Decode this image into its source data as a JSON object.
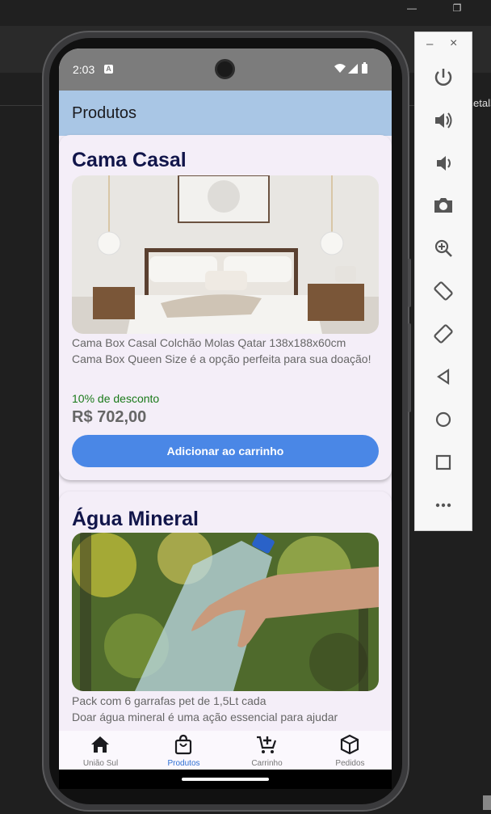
{
  "host": {
    "peek_text": "etalh"
  },
  "status_bar": {
    "time": "2:03",
    "notification_glyph": "A"
  },
  "app_bar": {
    "title": "Produtos"
  },
  "products": [
    {
      "title": "Cama Casal",
      "image": "bedroom-photo",
      "description": "Cama Box Casal Colchão Molas Qatar 138x188x60cm\nCama Box Queen Size é a opção perfeita para sua doação!",
      "discount": "10% de desconto",
      "price": "R$ 702,00",
      "button_label": "Adicionar ao carrinho"
    },
    {
      "title": "Água Mineral",
      "image": "water-bottle-photo",
      "description": "Pack com 6 garrafas pet de 1,5Lt cada\nDoar água mineral é uma ação essencial para ajudar comunidades em situações de emergência"
    }
  ],
  "bottom_nav": [
    {
      "label": "União Sul",
      "icon": "home-icon",
      "active": false
    },
    {
      "label": "Produtos",
      "icon": "shopping-bag-icon",
      "active": true
    },
    {
      "label": "Carrinho",
      "icon": "add-cart-icon",
      "active": false
    },
    {
      "label": "Pedidos",
      "icon": "package-icon",
      "active": false
    }
  ],
  "emulator_controls": {
    "minimize": "–",
    "close": "×",
    "buttons": [
      "power-icon",
      "volume-up-icon",
      "volume-down-icon",
      "camera-icon",
      "zoom-icon",
      "rotate-left-icon",
      "rotate-right-icon",
      "back-icon",
      "home-circle-icon",
      "overview-icon",
      "more-icon"
    ]
  },
  "colors": {
    "app_bar": "#a9c6e5",
    "title_text": "#11154a",
    "discount": "#1a7a1a",
    "button": "#4a87e6",
    "active_nav": "#2e6fd4"
  }
}
